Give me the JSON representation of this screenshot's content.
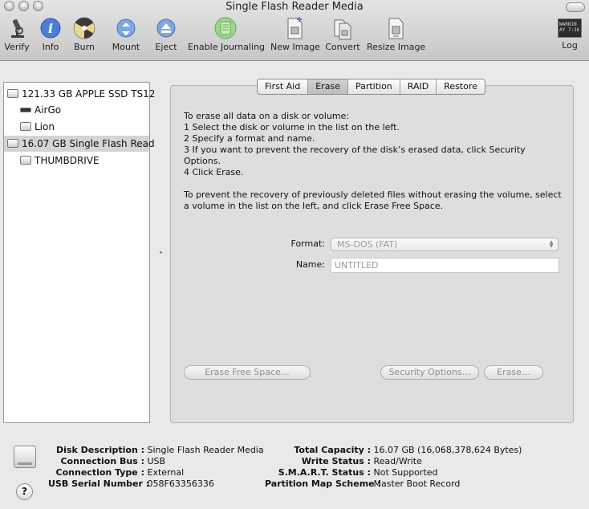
{
  "window": {
    "title": "Single Flash Reader Media"
  },
  "toolbar": {
    "verify": "Verify",
    "info": "Info",
    "burn": "Burn",
    "mount": "Mount",
    "eject": "Eject",
    "enable_journaling": "Enable Journaling",
    "new_image": "New Image",
    "convert": "Convert",
    "resize_image": "Resize Image",
    "log": "Log",
    "log_icon_text_1": "WARNIN",
    "log_icon_text_2": "AY 7:36"
  },
  "sidebar": {
    "items": [
      {
        "label": "121.33 GB APPLE SSD TS12",
        "icon": "internal-disk-icon",
        "selected": false
      },
      {
        "label": "AirGo",
        "icon": "volume-icon",
        "selected": false
      },
      {
        "label": "Lion",
        "icon": "volume-icon",
        "selected": false
      },
      {
        "label": "16.07 GB Single Flash Read",
        "icon": "external-disk-icon",
        "selected": true
      },
      {
        "label": "THUMBDRIVE",
        "icon": "volume-icon",
        "selected": false
      }
    ]
  },
  "tabs": [
    {
      "label": "First Aid",
      "active": false
    },
    {
      "label": "Erase",
      "active": true
    },
    {
      "label": "Partition",
      "active": false
    },
    {
      "label": "RAID",
      "active": false
    },
    {
      "label": "Restore",
      "active": false
    }
  ],
  "erase": {
    "instructions": "To erase all data on a disk or volume:\n1 Select the disk or volume in the list on the left.\n2 Specify a format and name.\n3 If you want to prevent the recovery of the disk’s erased data, click Security Options.\n4 Click Erase.\n\nTo prevent the recovery of previously deleted files without erasing the volume, select a volume in the list on the left, and click Erase Free Space.",
    "format_label": "Format:",
    "format_value": "MS-DOS (FAT)",
    "name_label": "Name:",
    "name_placeholder": "UNTITLED",
    "erase_free_space": "Erase Free Space…",
    "security_options": "Security Options…",
    "erase_button": "Erase…"
  },
  "info": {
    "disk_description_label": "Disk Description :",
    "disk_description": "Single Flash Reader Media",
    "connection_bus_label": "Connection Bus :",
    "connection_bus": "USB",
    "connection_type_label": "Connection Type :",
    "connection_type": "External",
    "usb_serial_label": "USB Serial Number :",
    "usb_serial": "058F63356336",
    "total_capacity_label": "Total Capacity :",
    "total_capacity": "16.07 GB (16,068,378,624 Bytes)",
    "write_status_label": "Write Status :",
    "write_status": "Read/Write",
    "smart_status_label": "S.M.A.R.T. Status :",
    "smart_status": "Not Supported",
    "partition_scheme_label": "Partition Map Scheme :",
    "partition_scheme": "Master Boot Record"
  },
  "help_label": "?"
}
